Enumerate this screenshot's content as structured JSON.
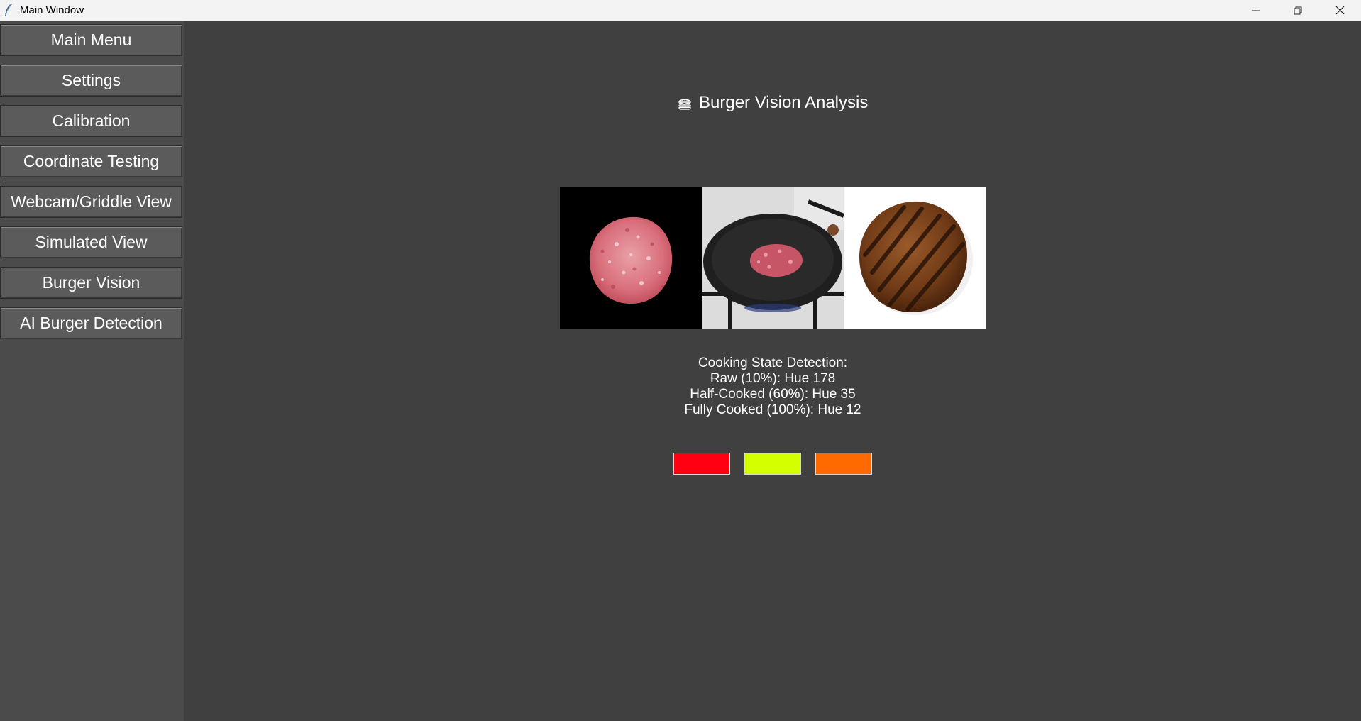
{
  "window": {
    "title": "Main Window",
    "controls": [
      "minimize-icon",
      "restore-icon",
      "close-icon"
    ]
  },
  "sidebar": {
    "items": [
      {
        "label": "Main Menu"
      },
      {
        "label": "Settings"
      },
      {
        "label": "Calibration"
      },
      {
        "label": "Coordinate Testing"
      },
      {
        "label": "Webcam/Griddle View"
      },
      {
        "label": "Simulated View"
      },
      {
        "label": "Burger Vision"
      },
      {
        "label": "AI Burger Detection"
      }
    ]
  },
  "main": {
    "heading": "Burger Vision Analysis",
    "heading_icon": "burger-icon",
    "images": [
      {
        "name": "raw-patty-image"
      },
      {
        "name": "half-cooked-pan-image"
      },
      {
        "name": "fully-cooked-patty-image"
      }
    ],
    "detection": {
      "title": "Cooking State Detection:",
      "lines": [
        "Raw (10%): Hue 178",
        "Half-Cooked (60%): Hue 35",
        "Fully Cooked (100%): Hue 12"
      ]
    },
    "swatches": [
      {
        "name": "raw",
        "color": "#ff0013"
      },
      {
        "name": "half-cooked",
        "color": "#d4ff00"
      },
      {
        "name": "fully-cooked",
        "color": "#ff6a00"
      }
    ]
  }
}
